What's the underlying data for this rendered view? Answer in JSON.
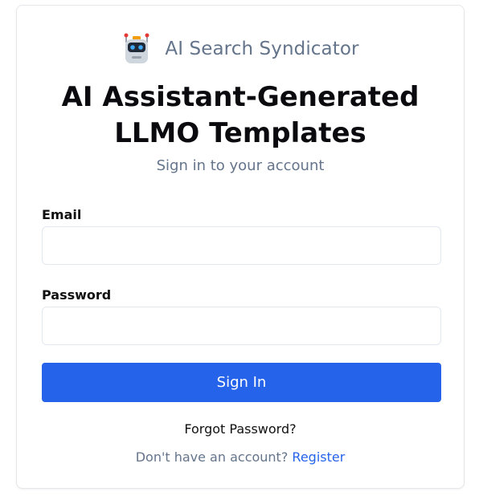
{
  "brand": {
    "icon": "robot-icon",
    "name": "AI Search Syndicator"
  },
  "title": {
    "line1": "AI Assistant-Generated",
    "line2": "LLMO Templates"
  },
  "subtitle": "Sign in to your account",
  "form": {
    "email_label": "Email",
    "email_value": "",
    "email_placeholder": "",
    "password_label": "Password",
    "password_value": "",
    "password_placeholder": "",
    "submit_label": "Sign In"
  },
  "links": {
    "forgot_password": "Forgot Password?",
    "no_account_text": "Don't have an account?",
    "register": "Register"
  },
  "colors": {
    "primary": "#2563eb",
    "muted_text": "#64748b",
    "border": "#e2e8f0"
  }
}
